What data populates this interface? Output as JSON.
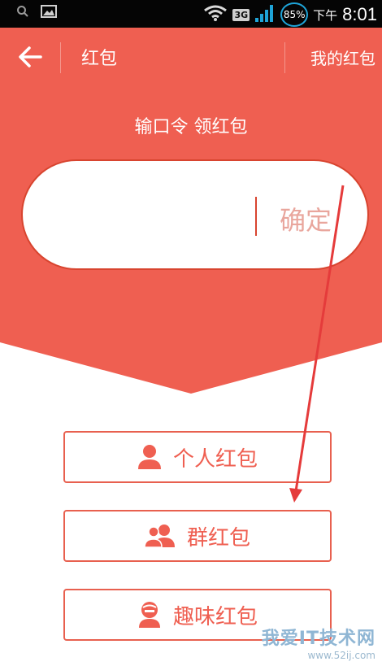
{
  "status_bar": {
    "network": "3G",
    "battery": "85%",
    "time_label": "下午",
    "time": "8:01"
  },
  "header": {
    "title": "红包",
    "right_link": "我的红包"
  },
  "main": {
    "prompt": "输口令 领红包",
    "code_input_value": "",
    "confirm_label": "确定"
  },
  "options": [
    {
      "label": "个人红包",
      "icon": "person-icon"
    },
    {
      "label": "群红包",
      "icon": "group-icon"
    },
    {
      "label": "趣味红包",
      "icon": "fun-face-icon"
    }
  ],
  "watermark": {
    "main": "我爱IT技术网",
    "sub": "www.52ij.com"
  },
  "colors": {
    "primary_red": "#ef5f51",
    "border_red": "#d8442f",
    "confirm_text": "#e9a69d",
    "annotation_arrow": "#e53b3b"
  }
}
